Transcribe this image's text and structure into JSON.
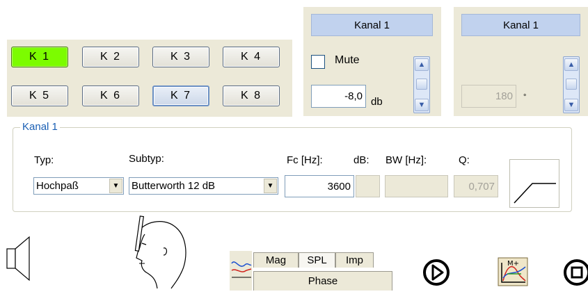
{
  "channels": {
    "buttons": [
      "K 1",
      "K 2",
      "K 3",
      "K 4",
      "K 5",
      "K 6",
      "K 7",
      "K 8"
    ],
    "active": "K 1",
    "focused": "K 7"
  },
  "gain_panel": {
    "header": "Kanal 1",
    "mute_label": "Mute",
    "mute_checked": false,
    "value": "-8,0",
    "unit": "db"
  },
  "phase_panel": {
    "header": "Kanal 1",
    "value": "180",
    "unit": "°"
  },
  "filter": {
    "group_title": "Kanal 1",
    "typ_label": "Typ:",
    "typ_value": "Hochpaß",
    "subtyp_label": "Subtyp:",
    "subtyp_value": "Butterworth 12 dB",
    "fc_label": "Fc [Hz]:",
    "fc_value": "3600",
    "db_label": "dB:",
    "bw_label": "BW [Hz]:",
    "q_label": "Q:",
    "q_value": "0,707",
    "curve_icon": "highpass-curve-icon"
  },
  "bottom": {
    "tabs": [
      "Mag",
      "SPL",
      "Imp"
    ],
    "selected_tab": "SPL",
    "phase_tab": "Phase",
    "icons": [
      "speaker-icon",
      "listener-head-icon",
      "graph-icon",
      "play-icon",
      "chart-marker-icon",
      "stop-icon"
    ]
  }
}
